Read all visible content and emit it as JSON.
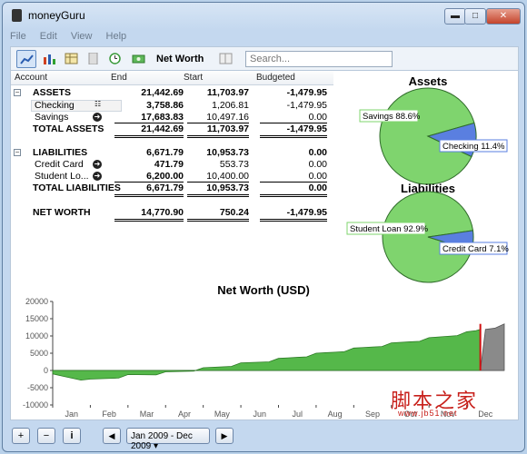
{
  "window": {
    "title": "moneyGuru",
    "controls": {
      "minimize": "▬",
      "maximize": "□",
      "close": "✕"
    }
  },
  "menu": [
    "File",
    "Edit",
    "View",
    "Help"
  ],
  "toolbar": {
    "view_label": "Net Worth",
    "search_placeholder": "Search..."
  },
  "sheet": {
    "columns": [
      "Account",
      "End",
      "Start",
      "Budgeted"
    ],
    "rows": [
      {
        "kind": "group",
        "account": "ASSETS",
        "end": "21,442.69",
        "start": "11,703.97",
        "budget": "-1,479.95"
      },
      {
        "kind": "child",
        "account": "Checking",
        "end": "3,758.86",
        "start": "1,206.81",
        "budget": "-1,479.95"
      },
      {
        "kind": "child",
        "account": "Savings",
        "end": "17,683.83",
        "start": "10,497.16",
        "budget": "0.00"
      },
      {
        "kind": "total",
        "account": "TOTAL ASSETS",
        "end": "21,442.69",
        "start": "11,703.97",
        "budget": "-1,479.95"
      },
      {
        "kind": "group",
        "account": "LIABILITIES",
        "end": "6,671.79",
        "start": "10,953.73",
        "budget": "0.00"
      },
      {
        "kind": "child",
        "account": "Credit Card",
        "end": "471.79",
        "start": "553.73",
        "budget": "0.00"
      },
      {
        "kind": "child",
        "account": "Student Lo...",
        "end": "6,200.00",
        "start": "10,400.00",
        "budget": "0.00"
      },
      {
        "kind": "total",
        "account": "TOTAL LIABILITIES",
        "end": "6,671.79",
        "start": "10,953.73",
        "budget": "0.00"
      },
      {
        "kind": "net",
        "account": "NET WORTH",
        "end": "14,770.90",
        "start": "750.24",
        "budget": "-1,479.95"
      }
    ]
  },
  "pies": {
    "assets": {
      "title": "Assets",
      "slices": [
        {
          "label": "Savings 88.6%",
          "value": 88.6,
          "color": "#7fd46e"
        },
        {
          "label": "Checking 11.4%",
          "value": 11.4,
          "color": "#5a7fe0"
        }
      ]
    },
    "liabilities": {
      "title": "Liabilities",
      "slices": [
        {
          "label": "Student Loan 92.9%",
          "value": 92.9,
          "color": "#7fd46e"
        },
        {
          "label": "Credit Card 7.1%",
          "value": 7.1,
          "color": "#5a7fe0"
        }
      ]
    }
  },
  "chart_data": {
    "type": "area",
    "title": "Net Worth (USD)",
    "x": [
      "Jan",
      "Feb",
      "Mar",
      "Apr",
      "May",
      "Jun",
      "Jul",
      "Aug",
      "Sep",
      "Oct",
      "Nov",
      "Dec"
    ],
    "yticks": [
      20000,
      15000,
      10000,
      5000,
      0,
      -5000,
      -10000
    ],
    "ylim": [
      -10000,
      20000
    ],
    "values": [
      -1000,
      -2500,
      -1200,
      -400,
      800,
      2200,
      3500,
      5000,
      6500,
      8000,
      9500,
      11200,
      13500
    ],
    "grid": false,
    "colors": {
      "area": "#55b84a",
      "future": "#8a8a8a",
      "today": "#d01010"
    }
  },
  "bottombar": {
    "add": "+",
    "remove": "−",
    "info": "i",
    "prev": "◀",
    "next": "▶",
    "daterange": "Jan 2009 - Dec 2009"
  },
  "watermark": {
    "main": "脚本之家",
    "sub": "www.jb51.net"
  }
}
